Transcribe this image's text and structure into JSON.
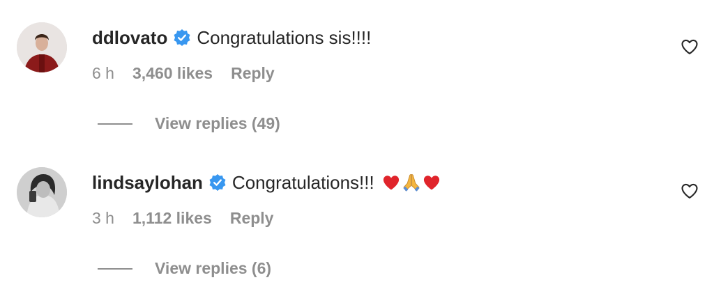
{
  "comments": [
    {
      "username": "ddlovato",
      "verified": true,
      "text": "Congratulations sis!!!!",
      "time": "6 h",
      "likes": "3,460 likes",
      "reply_label": "Reply",
      "view_replies": "View replies (49)"
    },
    {
      "username": "lindsaylohan",
      "verified": true,
      "text": "Congratulations!!!",
      "emojis": [
        "red-heart",
        "folded-hands",
        "red-heart"
      ],
      "time": "3 h",
      "likes": "1,112 likes",
      "reply_label": "Reply",
      "view_replies": "View replies (6)"
    }
  ],
  "colors": {
    "text": "#262626",
    "secondary": "#8e8e8e",
    "verified_blue": "#3897f0",
    "heart_red": "#e0242b"
  }
}
